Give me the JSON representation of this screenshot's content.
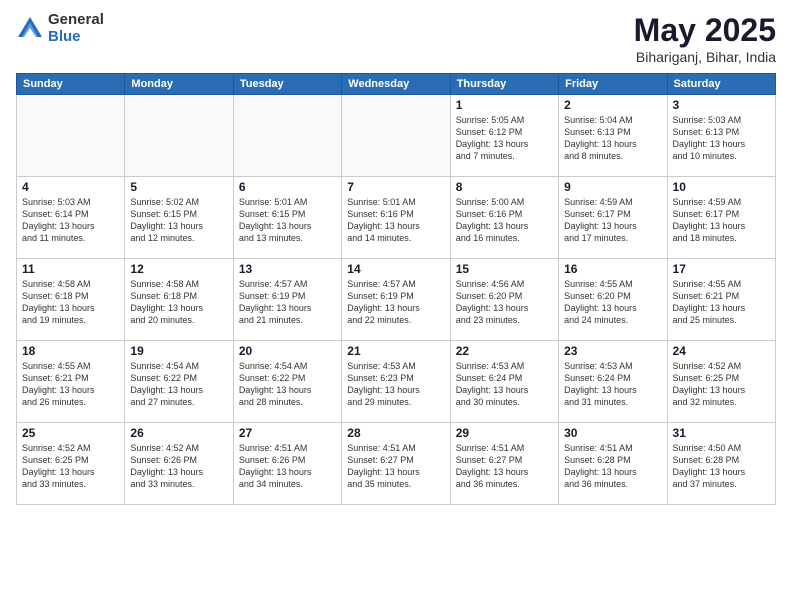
{
  "header": {
    "logo_general": "General",
    "logo_blue": "Blue",
    "title": "May 2025",
    "location": "Bihariganj, Bihar, India"
  },
  "weekdays": [
    "Sunday",
    "Monday",
    "Tuesday",
    "Wednesday",
    "Thursday",
    "Friday",
    "Saturday"
  ],
  "weeks": [
    [
      {
        "day": "",
        "info": ""
      },
      {
        "day": "",
        "info": ""
      },
      {
        "day": "",
        "info": ""
      },
      {
        "day": "",
        "info": ""
      },
      {
        "day": "1",
        "info": "Sunrise: 5:05 AM\nSunset: 6:12 PM\nDaylight: 13 hours\nand 7 minutes."
      },
      {
        "day": "2",
        "info": "Sunrise: 5:04 AM\nSunset: 6:13 PM\nDaylight: 13 hours\nand 8 minutes."
      },
      {
        "day": "3",
        "info": "Sunrise: 5:03 AM\nSunset: 6:13 PM\nDaylight: 13 hours\nand 10 minutes."
      }
    ],
    [
      {
        "day": "4",
        "info": "Sunrise: 5:03 AM\nSunset: 6:14 PM\nDaylight: 13 hours\nand 11 minutes."
      },
      {
        "day": "5",
        "info": "Sunrise: 5:02 AM\nSunset: 6:15 PM\nDaylight: 13 hours\nand 12 minutes."
      },
      {
        "day": "6",
        "info": "Sunrise: 5:01 AM\nSunset: 6:15 PM\nDaylight: 13 hours\nand 13 minutes."
      },
      {
        "day": "7",
        "info": "Sunrise: 5:01 AM\nSunset: 6:16 PM\nDaylight: 13 hours\nand 14 minutes."
      },
      {
        "day": "8",
        "info": "Sunrise: 5:00 AM\nSunset: 6:16 PM\nDaylight: 13 hours\nand 16 minutes."
      },
      {
        "day": "9",
        "info": "Sunrise: 4:59 AM\nSunset: 6:17 PM\nDaylight: 13 hours\nand 17 minutes."
      },
      {
        "day": "10",
        "info": "Sunrise: 4:59 AM\nSunset: 6:17 PM\nDaylight: 13 hours\nand 18 minutes."
      }
    ],
    [
      {
        "day": "11",
        "info": "Sunrise: 4:58 AM\nSunset: 6:18 PM\nDaylight: 13 hours\nand 19 minutes."
      },
      {
        "day": "12",
        "info": "Sunrise: 4:58 AM\nSunset: 6:18 PM\nDaylight: 13 hours\nand 20 minutes."
      },
      {
        "day": "13",
        "info": "Sunrise: 4:57 AM\nSunset: 6:19 PM\nDaylight: 13 hours\nand 21 minutes."
      },
      {
        "day": "14",
        "info": "Sunrise: 4:57 AM\nSunset: 6:19 PM\nDaylight: 13 hours\nand 22 minutes."
      },
      {
        "day": "15",
        "info": "Sunrise: 4:56 AM\nSunset: 6:20 PM\nDaylight: 13 hours\nand 23 minutes."
      },
      {
        "day": "16",
        "info": "Sunrise: 4:55 AM\nSunset: 6:20 PM\nDaylight: 13 hours\nand 24 minutes."
      },
      {
        "day": "17",
        "info": "Sunrise: 4:55 AM\nSunset: 6:21 PM\nDaylight: 13 hours\nand 25 minutes."
      }
    ],
    [
      {
        "day": "18",
        "info": "Sunrise: 4:55 AM\nSunset: 6:21 PM\nDaylight: 13 hours\nand 26 minutes."
      },
      {
        "day": "19",
        "info": "Sunrise: 4:54 AM\nSunset: 6:22 PM\nDaylight: 13 hours\nand 27 minutes."
      },
      {
        "day": "20",
        "info": "Sunrise: 4:54 AM\nSunset: 6:22 PM\nDaylight: 13 hours\nand 28 minutes."
      },
      {
        "day": "21",
        "info": "Sunrise: 4:53 AM\nSunset: 6:23 PM\nDaylight: 13 hours\nand 29 minutes."
      },
      {
        "day": "22",
        "info": "Sunrise: 4:53 AM\nSunset: 6:24 PM\nDaylight: 13 hours\nand 30 minutes."
      },
      {
        "day": "23",
        "info": "Sunrise: 4:53 AM\nSunset: 6:24 PM\nDaylight: 13 hours\nand 31 minutes."
      },
      {
        "day": "24",
        "info": "Sunrise: 4:52 AM\nSunset: 6:25 PM\nDaylight: 13 hours\nand 32 minutes."
      }
    ],
    [
      {
        "day": "25",
        "info": "Sunrise: 4:52 AM\nSunset: 6:25 PM\nDaylight: 13 hours\nand 33 minutes."
      },
      {
        "day": "26",
        "info": "Sunrise: 4:52 AM\nSunset: 6:26 PM\nDaylight: 13 hours\nand 33 minutes."
      },
      {
        "day": "27",
        "info": "Sunrise: 4:51 AM\nSunset: 6:26 PM\nDaylight: 13 hours\nand 34 minutes."
      },
      {
        "day": "28",
        "info": "Sunrise: 4:51 AM\nSunset: 6:27 PM\nDaylight: 13 hours\nand 35 minutes."
      },
      {
        "day": "29",
        "info": "Sunrise: 4:51 AM\nSunset: 6:27 PM\nDaylight: 13 hours\nand 36 minutes."
      },
      {
        "day": "30",
        "info": "Sunrise: 4:51 AM\nSunset: 6:28 PM\nDaylight: 13 hours\nand 36 minutes."
      },
      {
        "day": "31",
        "info": "Sunrise: 4:50 AM\nSunset: 6:28 PM\nDaylight: 13 hours\nand 37 minutes."
      }
    ]
  ]
}
